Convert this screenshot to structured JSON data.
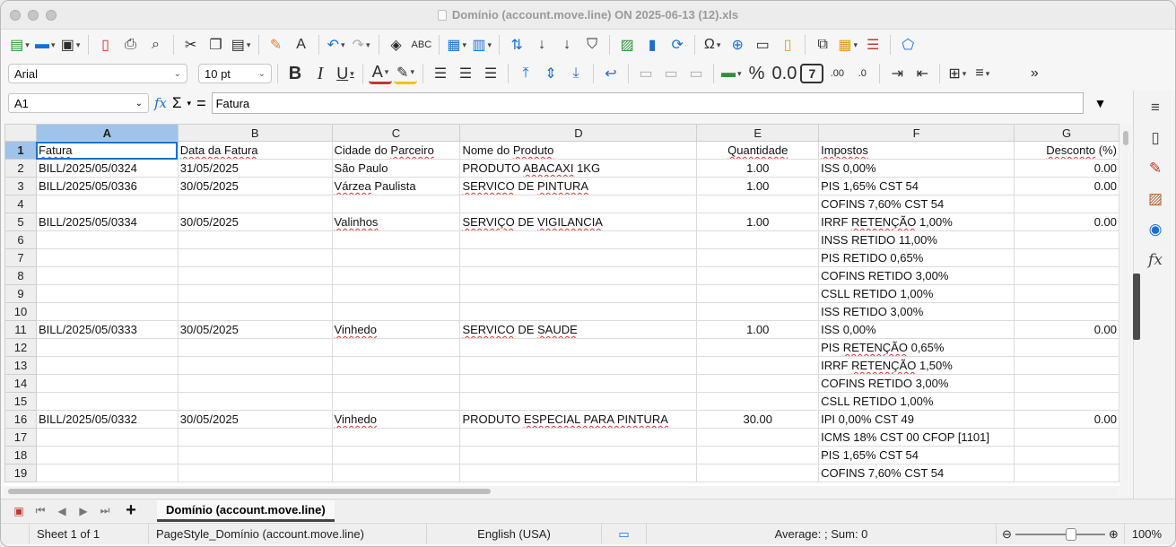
{
  "window": {
    "title": "Domínio (account.move.line) ON 2025-06-13 (12).xls"
  },
  "format": {
    "font_name": "Arial",
    "font_size": "10 pt"
  },
  "formula_bar": {
    "cell_ref": "A1",
    "sigma": "Σ",
    "equals": "=",
    "content": "Fatura"
  },
  "columns": [
    "A",
    "B",
    "C",
    "D",
    "E",
    "F",
    "G"
  ],
  "rows": [
    {
      "n": "1",
      "c": [
        "Fatura",
        "Data da Fatura",
        "Cidade do Parceiro",
        "Nome do Produto",
        "Quantidade",
        "Impostos",
        "Desconto (%)"
      ]
    },
    {
      "n": "2",
      "c": [
        "BILL/2025/05/0324",
        "31/05/2025",
        "São Paulo",
        "PRODUTO ABACAXI 1KG",
        "1.00",
        "ISS 0,00%",
        "0.00"
      ]
    },
    {
      "n": "3",
      "c": [
        "BILL/2025/05/0336",
        "30/05/2025",
        "Várzea Paulista",
        "SERVICO DE PINTURA",
        "1.00",
        "PIS 1,65% CST 54",
        "0.00"
      ]
    },
    {
      "n": "4",
      "c": [
        "",
        "",
        "",
        "",
        "",
        "COFINS 7,60% CST 54",
        ""
      ]
    },
    {
      "n": "5",
      "c": [
        "BILL/2025/05/0334",
        "30/05/2025",
        "Valinhos",
        "SERVIÇO DE VIGILANCIA",
        "1.00",
        "IRRF RETENÇÃO 1,00%",
        "0.00"
      ]
    },
    {
      "n": "6",
      "c": [
        "",
        "",
        "",
        "",
        "",
        "INSS RETIDO 11,00%",
        ""
      ]
    },
    {
      "n": "7",
      "c": [
        "",
        "",
        "",
        "",
        "",
        "PIS RETIDO 0,65%",
        ""
      ]
    },
    {
      "n": "8",
      "c": [
        "",
        "",
        "",
        "",
        "",
        "COFINS RETIDO 3,00%",
        ""
      ]
    },
    {
      "n": "9",
      "c": [
        "",
        "",
        "",
        "",
        "",
        "CSLL RETIDO 1,00%",
        ""
      ]
    },
    {
      "n": "10",
      "c": [
        "",
        "",
        "",
        "",
        "",
        "ISS RETIDO 3,00%",
        ""
      ]
    },
    {
      "n": "11",
      "c": [
        "BILL/2025/05/0333",
        "30/05/2025",
        "Vinhedo",
        "SERVICO DE SAUDE",
        "1.00",
        "ISS 0,00%",
        "0.00"
      ]
    },
    {
      "n": "12",
      "c": [
        "",
        "",
        "",
        "",
        "",
        "PIS RETENÇÃO 0,65%",
        ""
      ]
    },
    {
      "n": "13",
      "c": [
        "",
        "",
        "",
        "",
        "",
        "IRRF RETENÇÃO 1,50%",
        ""
      ]
    },
    {
      "n": "14",
      "c": [
        "",
        "",
        "",
        "",
        "",
        "COFINS RETIDO 3,00%",
        ""
      ]
    },
    {
      "n": "15",
      "c": [
        "",
        "",
        "",
        "",
        "",
        "CSLL RETIDO 1,00%",
        ""
      ]
    },
    {
      "n": "16",
      "c": [
        "BILL/2025/05/0332",
        "30/05/2025",
        "Vinhedo",
        "PRODUTO ESPECIAL PARA PINTURA",
        "30.00",
        "IPI 0,00% CST 49",
        "0.00"
      ]
    },
    {
      "n": "17",
      "c": [
        "",
        "",
        "",
        "",
        "",
        "ICMS 18% CST 00 CFOP [1101]",
        ""
      ]
    },
    {
      "n": "18",
      "c": [
        "",
        "",
        "",
        "",
        "",
        "PIS 1,65% CST 54",
        ""
      ]
    },
    {
      "n": "19",
      "c": [
        "",
        "",
        "",
        "",
        "",
        "COFINS 7,60% CST 54",
        ""
      ]
    }
  ],
  "sheet_tab": "Domínio (account.move.line)",
  "status": {
    "sheet": "Sheet 1 of 1",
    "page_style": "PageStyle_Domínio (account.move.line)",
    "language": "English (USA)",
    "summary": "Average: ; Sum: 0",
    "zoom": "100%"
  },
  "icons": [
    "new-icon",
    "open-icon",
    "save-icon",
    "export-pdf-icon",
    "print-icon",
    "print-preview-icon",
    "cut-icon",
    "copy-icon",
    "paste-icon",
    "clone-format-icon",
    "clear-format-icon",
    "undo-icon",
    "redo-icon",
    "find-icon",
    "spellcheck-icon",
    "row-icon",
    "column-icon",
    "sort-icon",
    "sort-asc-icon",
    "sort-desc-icon",
    "autofilter-icon",
    "image-icon",
    "chart-icon",
    "pivot-icon",
    "special-char-icon",
    "hyperlink-icon",
    "comment-icon",
    "header-footer-icon",
    "define-print-area-icon",
    "freeze-icon",
    "split-icon",
    "show-draw-icon"
  ]
}
